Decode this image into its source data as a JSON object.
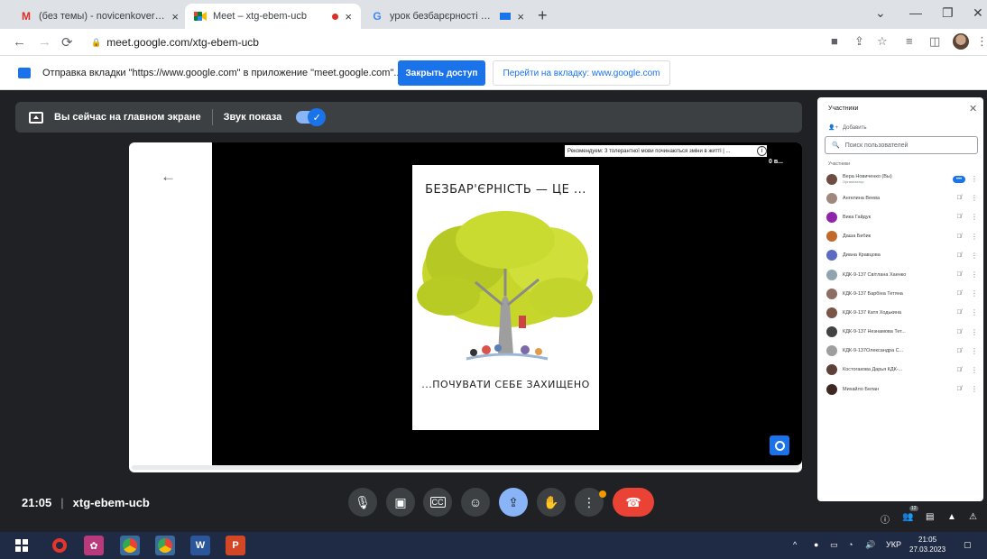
{
  "browser": {
    "tabs": [
      {
        "favicon": "M",
        "title": "(без темы) - novicenkovera@gm",
        "close": "×"
      },
      {
        "favicon": "meet-icon",
        "title": "Meet – xtg-ebem-ucb",
        "close": "×"
      },
      {
        "favicon": "G",
        "title": "урок безбарєрності вихов",
        "close": "×"
      }
    ],
    "new_tab": "+",
    "window_controls": {
      "minimize": "—",
      "maximize": "❐",
      "close": "✕",
      "list": "⌄"
    },
    "url": "meet.google.com/xtg-ebem-ucb"
  },
  "infobar": {
    "text": "Отправка вкладки \"https://www.google.com\" в приложение \"meet.google.com\"...",
    "stop_button": "Закрыть доступ",
    "switch_button": "Перейти на вкладку: www.google.com"
  },
  "meet": {
    "presenting_label": "Вы сейчас на главном экране",
    "sound_label": "Звук показа",
    "sound_enabled": true,
    "recording_chip": "Рекомендуем: 3 толерантної мови починаються зміни в житті | ...",
    "recording_time": "0 в...",
    "poster_title": "БЕЗБАР'ЄРНІСТЬ — ЦЕ ...",
    "poster_subtitle": "...ПОЧУВАТИ СЕБЕ ЗАХИЩЕНО",
    "time": "21:05",
    "meeting_code": "xtg-ebem-ucb",
    "colors": {
      "accent": "#1a73e8",
      "end_call": "#ea4335",
      "bg": "#202124"
    }
  },
  "participants": {
    "title": "Участники",
    "add_label": "Добавить",
    "search_placeholder": "Поиск пользователей",
    "section_label": "Участники",
    "people": [
      {
        "name": "Вера Новиченко (Вы)",
        "role": "Организатор",
        "avatar_color": "#6d4c41",
        "mic": "on"
      },
      {
        "name": "Ангелина Веева",
        "avatar_color": "#a1887f",
        "mic": "off"
      },
      {
        "name": "Вика Гайдук",
        "avatar_color": "#8e24aa",
        "mic": "off"
      },
      {
        "name": "Даша Бибик",
        "avatar_color": "#bf6a2b",
        "mic": "off"
      },
      {
        "name": "Диана Кравцова",
        "avatar_color": "#5c6bc0",
        "mic": "off"
      },
      {
        "name": "КДК-9-137 Світлана Хаенко",
        "avatar_color": "#90a4ae",
        "mic": "off"
      },
      {
        "name": "КДК-9-137 Барбіна Тетяна",
        "avatar_color": "#8d6e63",
        "mic": "off"
      },
      {
        "name": "КДК-9-137 Катя Ходькина",
        "avatar_color": "#795548",
        "mic": "off"
      },
      {
        "name": "КДК-9-137 Незнамова Тет...",
        "avatar_color": "#424242",
        "mic": "off"
      },
      {
        "name": "КДК-9-137Олександра С...",
        "avatar_color": "#9e9e9e",
        "mic": "off"
      },
      {
        "name": "Костогакова Дарья КДК-...",
        "avatar_color": "#5d4037",
        "mic": "off"
      },
      {
        "name": "Михайло Белан",
        "avatar_color": "#3e2723",
        "mic": "off"
      }
    ]
  },
  "taskbar": {
    "language": "УКР",
    "time": "21:05",
    "date": "27.03.2023",
    "badge": "12"
  }
}
